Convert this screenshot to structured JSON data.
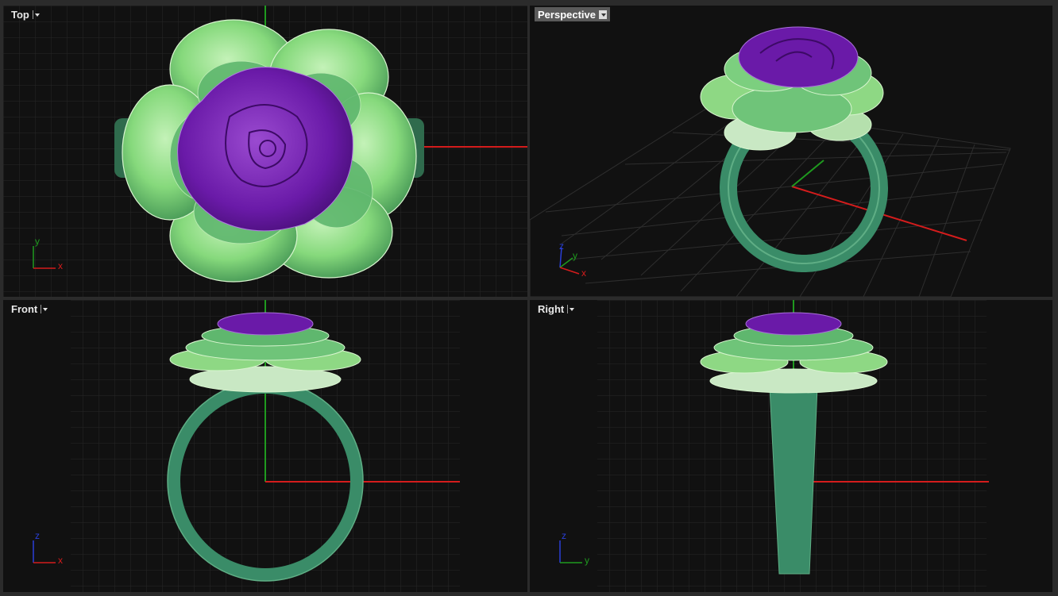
{
  "viewports": [
    {
      "id": "top",
      "name": "Top",
      "active": false,
      "axes": [
        "y",
        "x"
      ]
    },
    {
      "id": "perspective",
      "name": "Perspective",
      "active": true,
      "axes": [
        "z",
        "y",
        "x"
      ]
    },
    {
      "id": "front",
      "name": "Front",
      "active": false,
      "axes": [
        "z",
        "x"
      ]
    },
    {
      "id": "right",
      "name": "Right",
      "active": false,
      "axes": [
        "z",
        "y"
      ]
    }
  ],
  "colors": {
    "background": "#111111",
    "grid": "#2a2a2a",
    "x_axis": "#d41c1c",
    "y_axis": "#1f9a1f",
    "z_axis": "#2a3fd8",
    "petal_light": "#93e08a",
    "petal_mid": "#5fbe6f",
    "petal_pale": "#c9e8c4",
    "rose": "#6a1aa8",
    "band": "#3a8c68"
  },
  "icons": [
    "dropdown-arrow-icon",
    "axis-gizmo-icon"
  ]
}
